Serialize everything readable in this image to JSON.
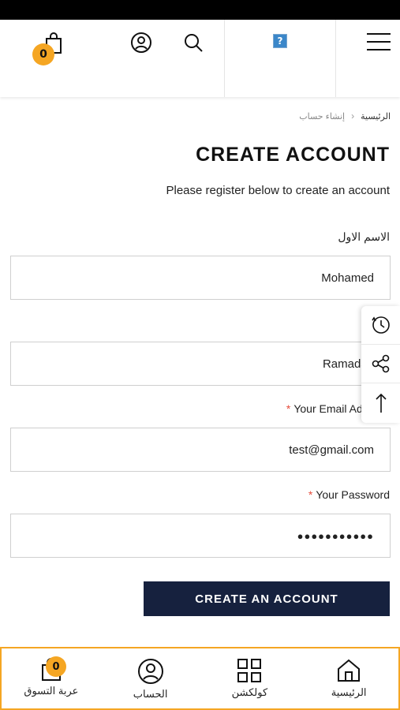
{
  "header": {
    "cart_count": "0",
    "logo_placeholder": "?"
  },
  "breadcrumb": {
    "home": "الرئيسية",
    "current": "إنشاء حساب"
  },
  "page": {
    "title": "CREATE ACCOUNT",
    "subtitle": "Please register below to create an account"
  },
  "form": {
    "first_name_label": "الاسم الاول",
    "first_name_value": "Mohamed",
    "last_name_value": "Ramadan",
    "email_label": "Your Email Address",
    "email_value": "test@gmail.com",
    "password_label": "Your Password",
    "password_value": "●●●●●●●●●●●",
    "submit_label": "CREATE AN ACCOUNT"
  },
  "bottom_nav": {
    "cart_label": "عربة التسوق",
    "cart_count": "0",
    "account_label": "الحساب",
    "collection_label": "كولكشن",
    "home_label": "الرئيسية"
  },
  "colors": {
    "accent": "#f5a623",
    "primary_button": "#16213e",
    "required": "#e74c3c"
  },
  "icons": [
    "cart-icon",
    "account-icon",
    "search-icon",
    "menu-icon",
    "history-icon",
    "share-icon",
    "arrow-up-icon",
    "grid-icon",
    "home-icon"
  ]
}
